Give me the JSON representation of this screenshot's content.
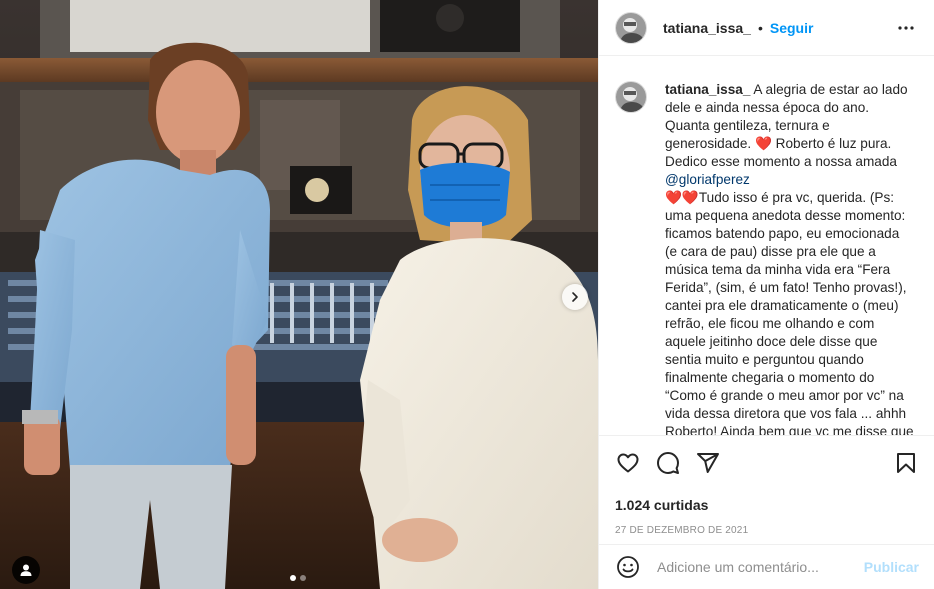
{
  "post": {
    "username": "tatiana_issa_",
    "separator": "•",
    "follow_label": "Seguir",
    "more_icon": "more-horizontal-icon"
  },
  "caption": {
    "username": "tatiana_issa_",
    "part1": " A alegria de estar ao lado dele e ainda nessa época do ano. Quanta gentileza, ternura e generosidade. ",
    "heart1": "❤️",
    "part2": " Roberto é luz pura. Dedico esse momento a nossa amada ",
    "mention": "@gloriafperez",
    "heart2": "❤️❤️",
    "part3": "Tudo isso é pra vc, querida. (Ps: uma pequena anedota desse momento: ficamos batendo papo, eu emocionada (e cara de pau) disse pra ele que a música tema da minha vida era “Fera Ferida”, (sim, é um fato! Tenho provas!), cantei pra ele dramaticamente o (meu) refrão, ele ficou me olhando e com aquele jeitinho doce dele disse que sentia muito e perguntou quando finalmente chegaria o momento do “Como é grande o meu amor por vc” na vida dessa diretora que vos fala ... ahhh Roberto! Ainda bem que vc me disse que eu ainda vou viver isso um dia"
  },
  "actions": {
    "like_icon": "heart-icon",
    "comment_icon": "comment-icon",
    "share_icon": "share-icon",
    "save_icon": "bookmark-icon",
    "likes_text": "1.024 curtidas",
    "date_text": "27 DE DEZEMBRO DE 2021"
  },
  "comment": {
    "placeholder": "Adicione um comentário...",
    "publish_label": "Publicar",
    "emoji_icon": "smiley-icon"
  },
  "media": {
    "next_icon": "chevron-right-icon",
    "tag_icon": "user-tag-icon",
    "carousel_count": 2,
    "carousel_active": 1
  },
  "colors": {
    "accent": "#0095f6",
    "publish_disabled": "#b2dffc",
    "like_heart": "#ed4956",
    "mention": "#00376b"
  }
}
